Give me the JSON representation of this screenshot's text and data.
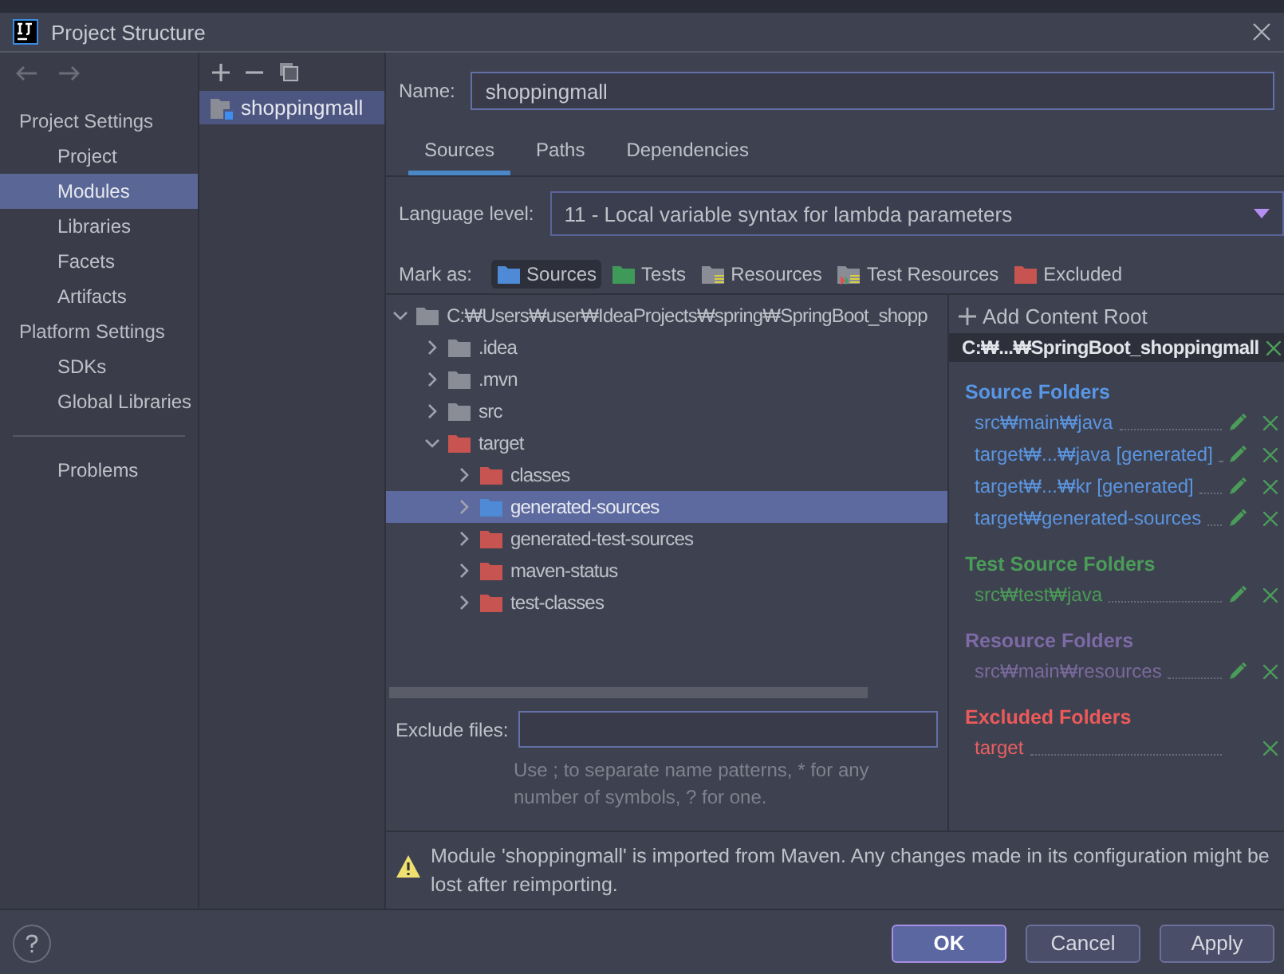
{
  "window": {
    "title": "Project Structure"
  },
  "sidebar": {
    "sections": [
      {
        "title": "Project Settings",
        "items": [
          {
            "label": "Project",
            "selected": false
          },
          {
            "label": "Modules",
            "selected": true
          },
          {
            "label": "Libraries",
            "selected": false
          },
          {
            "label": "Facets",
            "selected": false
          },
          {
            "label": "Artifacts",
            "selected": false
          }
        ]
      },
      {
        "title": "Platform Settings",
        "items": [
          {
            "label": "SDKs",
            "selected": false
          },
          {
            "label": "Global Libraries",
            "selected": false
          }
        ]
      }
    ],
    "extra_items": [
      {
        "label": "Problems",
        "selected": false
      }
    ]
  },
  "modules": [
    {
      "name": "shoppingmall",
      "selected": true
    }
  ],
  "name_field": {
    "label": "Name:",
    "value": "shoppingmall"
  },
  "tabs": [
    {
      "label": "Sources",
      "selected": true
    },
    {
      "label": "Paths",
      "selected": false
    },
    {
      "label": "Dependencies",
      "selected": false
    }
  ],
  "language_level": {
    "label": "Language level:",
    "value": "11 - Local variable syntax for lambda parameters"
  },
  "mark_as": {
    "label": "Mark as:",
    "options": [
      {
        "label": "Sources",
        "kind": "source",
        "selected": true
      },
      {
        "label": "Tests",
        "kind": "test",
        "selected": false
      },
      {
        "label": "Resources",
        "kind": "resource",
        "selected": false
      },
      {
        "label": "Test Resources",
        "kind": "test-resource",
        "selected": false
      },
      {
        "label": "Excluded",
        "kind": "excluded",
        "selected": false
      }
    ]
  },
  "tree": [
    {
      "label": "C:₩Users₩user₩IdeaProjects₩spring₩SpringBoot_shopp",
      "kind": "plain",
      "expanded": true,
      "selected": false,
      "children": [
        {
          "label": ".idea",
          "kind": "plain",
          "expanded": false,
          "selected": false
        },
        {
          "label": ".mvn",
          "kind": "plain",
          "expanded": false,
          "selected": false
        },
        {
          "label": "src",
          "kind": "plain",
          "expanded": false,
          "selected": false
        },
        {
          "label": "target",
          "kind": "excluded",
          "expanded": true,
          "selected": false,
          "children": [
            {
              "label": "classes",
              "kind": "excluded",
              "expanded": false,
              "selected": false
            },
            {
              "label": "generated-sources",
              "kind": "source",
              "expanded": false,
              "selected": true
            },
            {
              "label": "generated-test-sources",
              "kind": "excluded",
              "expanded": false,
              "selected": false
            },
            {
              "label": "maven-status",
              "kind": "excluded",
              "expanded": false,
              "selected": false
            },
            {
              "label": "test-classes",
              "kind": "excluded",
              "expanded": false,
              "selected": false
            }
          ]
        }
      ]
    }
  ],
  "exclude_files": {
    "label": "Exclude files:",
    "hint": "Use ; to separate name patterns, * for any number of symbols, ? for one."
  },
  "content_root": {
    "add_label": "Add Content Root",
    "path": "C:₩...₩SpringBoot_shoppingmall",
    "groups": [
      {
        "title": "Source Folders",
        "kind": "source",
        "folders": [
          "src₩main₩java",
          "target₩...₩java [generated]",
          "target₩...₩kr [generated]",
          "target₩generated-sources"
        ]
      },
      {
        "title": "Test Source Folders",
        "kind": "test",
        "folders": [
          "src₩test₩java"
        ]
      },
      {
        "title": "Resource Folders",
        "kind": "resource",
        "folders": [
          "src₩main₩resources"
        ]
      },
      {
        "title": "Excluded Folders",
        "kind": "excluded",
        "folders": [
          "target"
        ]
      }
    ]
  },
  "warning": "Module 'shoppingmall' is imported from Maven. Any changes made in its configuration might be lost after reimporting.",
  "buttons": [
    {
      "label": "OK",
      "default": true
    },
    {
      "label": "Cancel",
      "default": false
    },
    {
      "label": "Apply",
      "default": false
    }
  ]
}
